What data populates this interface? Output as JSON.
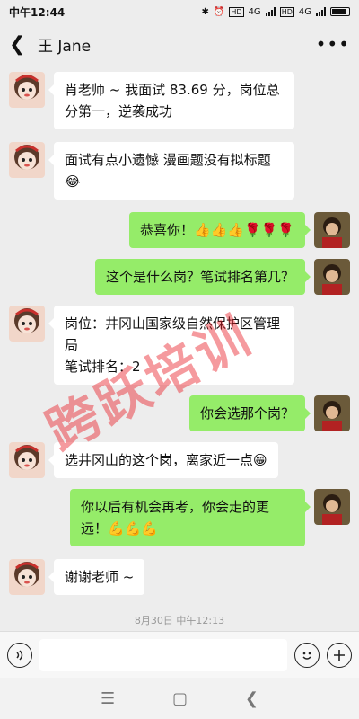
{
  "status_bar": {
    "time": "中午12:44",
    "network1": "4G",
    "network2": "4G",
    "hd1": "HD",
    "hd2": "HD"
  },
  "header": {
    "back_icon": "chevron-left",
    "title": "王  Jane",
    "more_icon": "more-dots"
  },
  "messages": [
    {
      "side": "left",
      "text": "肖老师 ~ 我面试 83.69 分，岗位总分第一，逆袭成功"
    },
    {
      "side": "left",
      "text": "面试有点小遗憾 漫画题没有拟标题😂"
    },
    {
      "side": "right",
      "text": "恭喜你！👍👍👍🌹🌹🌹"
    },
    {
      "side": "right",
      "text": "这个是什么岗？笔试排名第几？"
    },
    {
      "side": "left",
      "text": "岗位：井冈山国家级自然保护区管理局\n笔试排名：2"
    },
    {
      "side": "right",
      "text": "你会选那个岗？"
    },
    {
      "side": "left",
      "text": "选井冈山的这个岗，离家近一点😁"
    },
    {
      "side": "right",
      "text": "你以后有机会再考，你会走的更远！💪💪💪"
    },
    {
      "side": "left",
      "text": "谢谢老师 ~"
    }
  ],
  "timestamp": "8月30日 中午12:13",
  "watermark": "跨跃培训",
  "input_bar": {
    "voice_icon": "voice-icon",
    "emoji_icon": "emoji-icon",
    "plus_icon": "plus-icon"
  },
  "nav_bar": {
    "menu_icon": "menu-icon",
    "home_icon": "home-icon",
    "back_icon": "back-icon"
  },
  "colors": {
    "background": "#ededed",
    "self_bubble": "#95ec69",
    "other_bubble": "#ffffff",
    "watermark": "#e81e28"
  }
}
